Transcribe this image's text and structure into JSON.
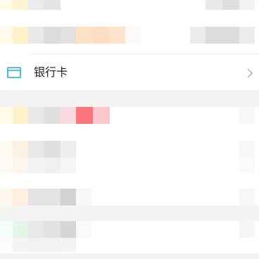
{
  "bank_card": {
    "label": "银行卡",
    "icon": "card-icon",
    "chevron_icon": "chevron-right-icon",
    "icon_color": "#1ab0d8"
  }
}
